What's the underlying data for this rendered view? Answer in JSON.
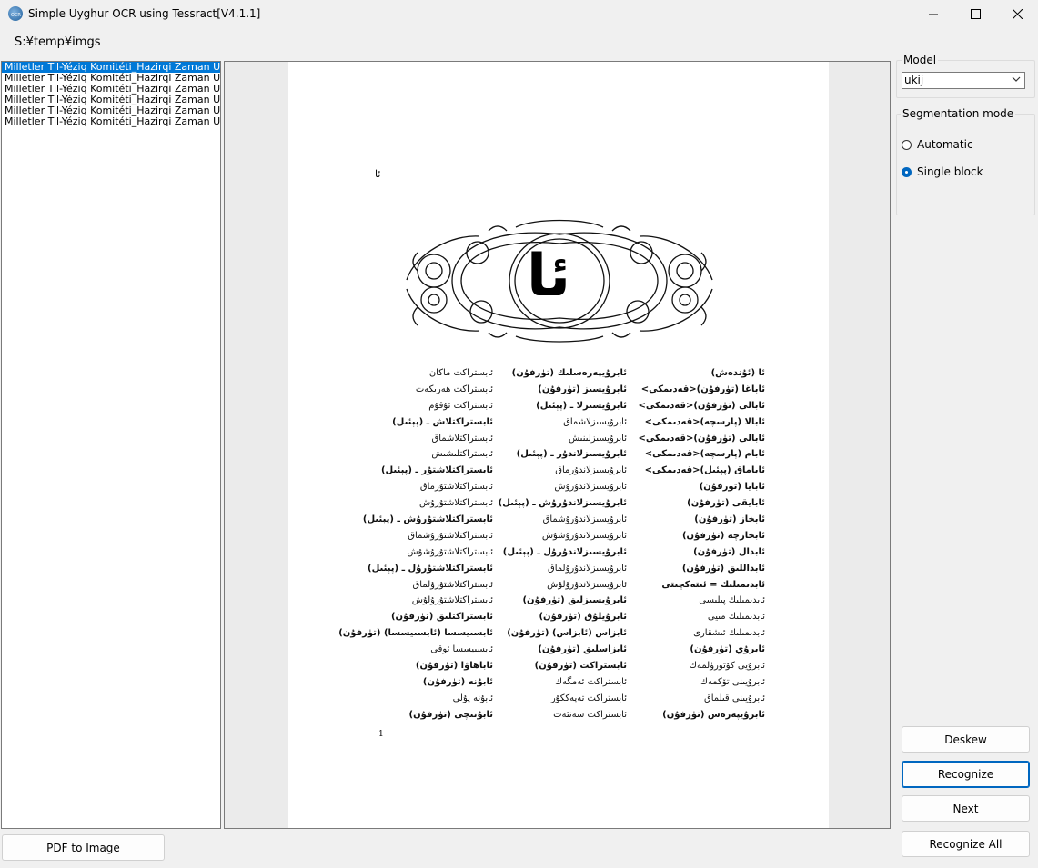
{
  "window": {
    "title": "Simple Uyghur OCR using Tessract[V4.1.1]",
    "minimize_glyph": "—",
    "close_glyph": "✕"
  },
  "path_label": "S:¥temp¥imgs",
  "files": [
    {
      "name": "Milletler Til-Yéziq Komitéti_Hazirqi Zaman Uyghur Tilining Imla Lughiti",
      "selected": true
    },
    {
      "name": "Milletler Til-Yéziq Komitéti_Hazirqi Zaman Uyghur Tilining Imla Lughiti",
      "selected": false
    },
    {
      "name": "Milletler Til-Yéziq Komitéti_Hazirqi Zaman Uyghur Tilining Imla Lughiti",
      "selected": false
    },
    {
      "name": "Milletler Til-Yéziq Komitéti_Hazirqi Zaman Uyghur Tilining Imla Lughiti",
      "selected": false
    },
    {
      "name": "Milletler Til-Yéziq Komitéti_Hazirqi Zaman Uyghur Tilining Imla Lughiti",
      "selected": false
    },
    {
      "name": "Milletler Til-Yéziq Komitéti_Hazirqi Zaman Uyghur Tilining Imla Lughiti",
      "selected": false
    }
  ],
  "document_page": {
    "header_glyph": "ئا",
    "big_letter": "ئا",
    "page_number": "1",
    "columns": [
      [
        {
          "t": "ئا (ئۇندەش)",
          "b": true
        },
        {
          "t": "ئاباغا (تۈرفۇن)<قەدىمكى>",
          "b": true
        },
        {
          "t": "ئابالى (تۈرفۇن)<قەدىمكى>",
          "b": true
        },
        {
          "t": "ئابالا (پارسچە)<قەدىمكى>",
          "b": true
        },
        {
          "t": "ئابالى (تۈرفۇن)<قەدىمكى>",
          "b": true
        },
        {
          "t": "ئابام (پارسچە)<قەدىمكى>",
          "b": true
        },
        {
          "t": "ئاباماق (پېئىل)<قەدىمكى>",
          "b": true
        },
        {
          "t": "ئابايا (تۈرفۇن)",
          "b": true
        },
        {
          "t": "ئابايقى (تۈرفۇن)",
          "b": true
        },
        {
          "t": "ئابخاز (تۈرفۇن)",
          "b": true
        },
        {
          "t": "ئابخازچە (تۈرفۇن)",
          "b": true
        },
        {
          "t": "ئابدال (تۈرفۇن)",
          "b": true
        },
        {
          "t": "ئابداللىق (تۈرفۇن)",
          "b": true
        },
        {
          "t": "ئابدىمىلىك = ئىتەكچىتى",
          "b": true
        },
        {
          "t": "ئابدىمىلىك پىلىسى",
          "b": false
        },
        {
          "t": "ئابدىمىلىك مىيى",
          "b": false
        },
        {
          "t": "ئابدىمىلىك ئىشقارى",
          "b": false
        },
        {
          "t": "ئابرۇي (تۈرفۇن)",
          "b": true
        },
        {
          "t": "ئابرۇيى كۆتۈرۈلمەك",
          "b": false
        },
        {
          "t": "ئابرۇيىنى تۆكمەك",
          "b": false
        },
        {
          "t": "ئابرۇيىنى قىلماق",
          "b": false
        },
        {
          "t": "ئابرۇيپەرەس (تۈرفۇن)",
          "b": true
        }
      ],
      [
        {
          "t": "ئابرۇيپەرەسلىك (تۈرفۇن)",
          "b": true
        },
        {
          "t": "ئابرۇيسىز (تۈرفۇن)",
          "b": true
        },
        {
          "t": "ئابرۇيسىزلا ـ (پېئىل)",
          "b": true
        },
        {
          "t": "ئابرۇيسىزلاشماق",
          "b": false
        },
        {
          "t": "ئابرۇيسىزلىنىش",
          "b": false
        },
        {
          "t": "ئابرۇيسىزلاندۇر ـ (پېئىل)",
          "b": true
        },
        {
          "t": "ئابرۇيسىزلاندۇرماق",
          "b": false
        },
        {
          "t": "ئابرۇيسىزلاندۇرۇش",
          "b": false
        },
        {
          "t": "ئابرۇيسىزلاندۇرۇش ـ (پېئىل)",
          "b": true
        },
        {
          "t": "ئابرۇيسىزلاندۇرۇشماق",
          "b": false
        },
        {
          "t": "ئابرۇيسىزلاندۇرۇشۇش",
          "b": false
        },
        {
          "t": "ئابرۇيسىزلاندۇرۇل ـ (پېئىل)",
          "b": true
        },
        {
          "t": "ئابرۇيسىزلاندۇرۇلماق",
          "b": false
        },
        {
          "t": "ئابرۇيسىزلاندۇرۇلۇش",
          "b": false
        },
        {
          "t": "ئابرۇيسىزلىق (تۈرفۇن)",
          "b": true
        },
        {
          "t": "ئابرۇيلۇق (تۈرفۇن)",
          "b": true
        },
        {
          "t": "ئابزاس (ئابزاس) (تۈرفۇن)",
          "b": true
        },
        {
          "t": "ئابزاسلىق (تۈرفۇن)",
          "b": true
        },
        {
          "t": "ئابستراكت (تۈرفۇن)",
          "b": true
        },
        {
          "t": "ئابستراكت ئەمگەك",
          "b": false
        },
        {
          "t": "ئابستراكت تەپەككۇر",
          "b": false
        },
        {
          "t": "ئابستراكت سەنئەت",
          "b": false
        }
      ],
      [
        {
          "t": "ئابستراكت ماكان",
          "b": false
        },
        {
          "t": "ئابستراكت ھەرىكەت",
          "b": false
        },
        {
          "t": "ئابستراكت ئۇقۇم",
          "b": false
        },
        {
          "t": "ئابستراكتلاش ـ (پېئىل)",
          "b": true
        },
        {
          "t": "ئابستراكتلاشماق",
          "b": false
        },
        {
          "t": "ئابستراكتلىشىش",
          "b": false
        },
        {
          "t": "ئابستراكتلاشتۇر ـ (پېئىل)",
          "b": true
        },
        {
          "t": "ئابستراكتلاشتۇرماق",
          "b": false
        },
        {
          "t": "ئابستراكتلاشتۇرۇش",
          "b": false
        },
        {
          "t": "ئابستراكتلاشتۇرۇش ـ (پېئىل)",
          "b": true
        },
        {
          "t": "ئابستراكتلاشتۇرۇشماق",
          "b": false
        },
        {
          "t": "ئابستراكتلاشتۇرۇشۇش",
          "b": false
        },
        {
          "t": "ئابستراكتلاشتۇرۇل ـ (پېئىل)",
          "b": true
        },
        {
          "t": "ئابستراكتلاشتۇرۇلماق",
          "b": false
        },
        {
          "t": "ئابستراكتلاشتۇرۇلۇش",
          "b": false
        },
        {
          "t": "ئابستراكتلىق (تۈرفۇن)",
          "b": true
        },
        {
          "t": "ئابسىيسسا (ئابسىيسسا) (تۈرفۇن)",
          "b": true
        },
        {
          "t": "ئابسىيسسا ئوقى",
          "b": false
        },
        {
          "t": "ئاباھاۋا (تۈرفۇن)",
          "b": true
        },
        {
          "t": "ئابۇنە (تۈرفۇن)",
          "b": true
        },
        {
          "t": "ئابۇنە پۇلى",
          "b": false
        },
        {
          "t": "ئابۇنىچى (تۈرفۇن)",
          "b": true
        }
      ]
    ]
  },
  "model": {
    "group_label": "Model",
    "selected": "ukij"
  },
  "segmentation": {
    "group_label": "Segmentation mode",
    "options": [
      {
        "label": "Automatic",
        "checked": false
      },
      {
        "label": "Single block",
        "checked": true
      }
    ]
  },
  "buttons": {
    "pdf_to_image": "PDF to Image",
    "deskew": "Deskew",
    "recognize": "Recognize",
    "next": "Next",
    "recognize_all": "Recognize All"
  }
}
